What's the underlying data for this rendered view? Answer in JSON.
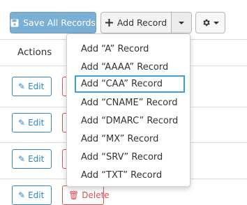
{
  "toolbar": {
    "save_label": "Save All Records",
    "add_label": "Add Record"
  },
  "table": {
    "actions_header": "Actions",
    "edit_label": "Edit",
    "delete_label": "Delete"
  },
  "menu": {
    "items": [
      {
        "label": "Add “A” Record"
      },
      {
        "label": "Add “AAAA” Record"
      },
      {
        "label": "Add “CAA” Record",
        "focused": true
      },
      {
        "label": "Add “CNAME” Record"
      },
      {
        "label": "Add “DMARC” Record"
      },
      {
        "label": "Add “MX” Record"
      },
      {
        "label": "Add “SRV” Record"
      },
      {
        "label": "Add “TXT” Record"
      }
    ]
  },
  "colors": {
    "primary": "#7bafd4",
    "edit_blue": "#2f86c6",
    "delete_red": "#d9534f",
    "focus_ring": "#3c9fdc"
  },
  "icons": {
    "save": "floppy-disk-icon",
    "add": "plus-icon",
    "dropdown": "caret-down-icon",
    "settings": "gear-icon",
    "edit": "pencil-icon",
    "delete": "trash-icon"
  }
}
